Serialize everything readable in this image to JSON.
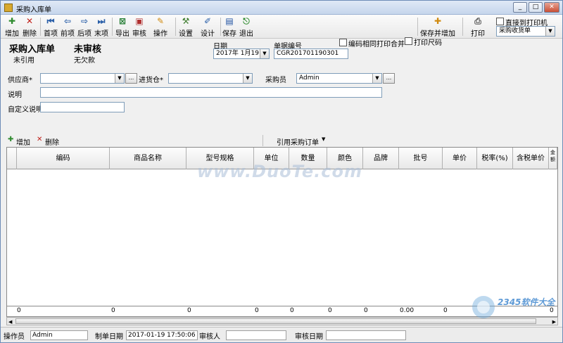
{
  "window": {
    "title": "采购入库单",
    "min": "_",
    "max": "□",
    "close": "✕"
  },
  "toolbar": {
    "add": "增加",
    "delete": "删除",
    "first": "首项",
    "prev": "前项",
    "next": "后项",
    "last": "末项",
    "export": "导出",
    "audit": "审核",
    "operate": "操作",
    "settings": "设置",
    "design": "设计",
    "save": "保存",
    "exit": "退出",
    "save_add": "保存并增加",
    "print": "打印",
    "direct_print_label": "直接到打印机",
    "print_template": "采购收货单"
  },
  "header": {
    "doc_title": "采购入库单",
    "ref_status": "未引用",
    "audit_status": "未审核",
    "payment_status": "无欠款",
    "date_label": "日期",
    "date_value": "2017年 1月19日",
    "docno_label": "单据编号",
    "docno_value": "CGR201701190301",
    "merge_print_label": "编码相同打印合并",
    "ruler_print_label": "打印尺码"
  },
  "form": {
    "supplier_label": "供应商*",
    "warehouse_label": "进货仓*",
    "buyer_label": "采购员",
    "buyer_value": "Admin",
    "note_label": "说明",
    "custom_note_label": "自定义说明"
  },
  "grid": {
    "add": "增加",
    "delete": "删除",
    "ref_order": "引用采购订单",
    "columns": [
      "编码",
      "商品名称",
      "型号规格",
      "单位",
      "数量",
      "颜色",
      "品牌",
      "批号",
      "单价",
      "税率(%)",
      "含税单价",
      "金额"
    ],
    "totals": [
      "0",
      "0",
      "0",
      "0",
      "0",
      "0",
      "0",
      "0.00",
      "0",
      "0"
    ]
  },
  "status": {
    "operator_label": "操作员",
    "operator_value": "Admin",
    "created_label": "制单日期",
    "created_value": "2017-01-19 17:50:06",
    "auditor_label": "审核人",
    "audit_date_label": "审核日期"
  },
  "watermark": {
    "center": "www.DuoTe.com",
    "brand": "2345软件大全"
  }
}
